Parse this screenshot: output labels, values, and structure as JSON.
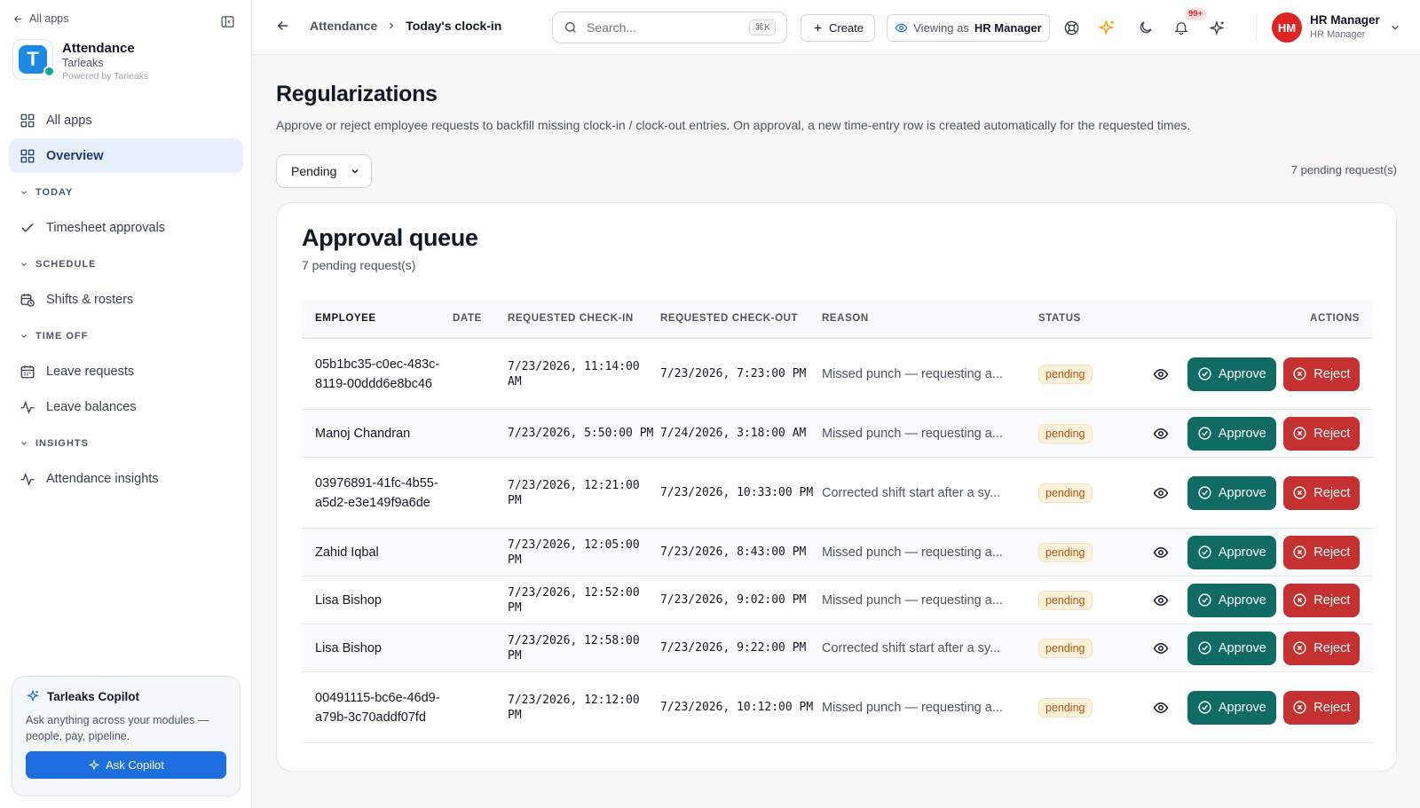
{
  "sidebar": {
    "all_apps_link": "All apps",
    "brand": {
      "name": "Attendance",
      "org": "Tarleaks",
      "powered": "Powered by Tarleaks",
      "logo_letter": "T"
    },
    "items": [
      {
        "label": "All apps",
        "icon": "grid-icon"
      },
      {
        "label": "Overview",
        "icon": "grid-icon",
        "active": true
      }
    ],
    "sections": [
      {
        "title": "TODAY",
        "items": [
          {
            "label": "Timesheet approvals",
            "icon": "check-icon"
          }
        ]
      },
      {
        "title": "SCHEDULE",
        "items": [
          {
            "label": "Shifts & rosters",
            "icon": "calendar-clock-icon"
          }
        ]
      },
      {
        "title": "TIME OFF",
        "items": [
          {
            "label": "Leave requests",
            "icon": "calendar-icon"
          },
          {
            "label": "Leave balances",
            "icon": "activity-icon"
          }
        ]
      },
      {
        "title": "INSIGHTS",
        "items": [
          {
            "label": "Attendance insights",
            "icon": "activity-icon"
          }
        ]
      }
    ],
    "copilot": {
      "title": "Tarleaks Copilot",
      "description": "Ask anything across your modules — people, pay, pipeline.",
      "button": "Ask Copilot"
    }
  },
  "topbar": {
    "breadcrumb": [
      "Attendance",
      "Today's clock-in"
    ],
    "search_placeholder": "Search...",
    "search_shortcut": "⌘K",
    "create_label": "Create",
    "viewing_label": "Viewing as",
    "viewing_role": "HR Manager",
    "notifications_badge": "99+",
    "user": {
      "initials": "HM",
      "name": "HR Manager",
      "role": "HR Manager"
    }
  },
  "page": {
    "title": "Regularizations",
    "description": "Approve or reject employee requests to backfill missing clock-in / clock-out entries. On approval, a new time-entry row is created automatically for the requested times.",
    "filter_value": "Pending",
    "pending_count": "7 pending request(s)"
  },
  "queue": {
    "title": "Approval queue",
    "subtitle": "7 pending request(s)",
    "columns": [
      "EMPLOYEE",
      "DATE",
      "REQUESTED CHECK-IN",
      "REQUESTED CHECK-OUT",
      "REASON",
      "STATUS",
      "ACTIONS"
    ],
    "approve_label": "Approve",
    "reject_label": "Reject",
    "rows": [
      {
        "employee": "05b1bc35-c0ec-483c-8119-00ddd6e8bc46",
        "date": "",
        "check_in": "7/23/2026, 11:14:00 AM",
        "check_out": "7/23/2026, 7:23:00 PM",
        "reason": "Missed punch — requesting a...",
        "status": "pending"
      },
      {
        "employee": "Manoj Chandran",
        "date": "",
        "check_in": "7/23/2026, 5:50:00 PM",
        "check_out": "7/24/2026, 3:18:00 AM",
        "reason": "Missed punch — requesting a...",
        "status": "pending"
      },
      {
        "employee": "03976891-41fc-4b55-a5d2-e3e149f9a6de",
        "date": "",
        "check_in": "7/23/2026, 12:21:00 PM",
        "check_out": "7/23/2026, 10:33:00 PM",
        "reason": "Corrected shift start after a sy...",
        "status": "pending"
      },
      {
        "employee": "Zahid Iqbal",
        "date": "",
        "check_in": "7/23/2026, 12:05:00 PM",
        "check_out": "7/23/2026, 8:43:00 PM",
        "reason": "Missed punch — requesting a...",
        "status": "pending"
      },
      {
        "employee": "Lisa Bishop",
        "date": "",
        "check_in": "7/23/2026, 12:52:00 PM",
        "check_out": "7/23/2026, 9:02:00 PM",
        "reason": "Missed punch — requesting a...",
        "status": "pending"
      },
      {
        "employee": "Lisa Bishop",
        "date": "",
        "check_in": "7/23/2026, 12:58:00 PM",
        "check_out": "7/23/2026, 9:22:00 PM",
        "reason": "Corrected shift start after a sy...",
        "status": "pending"
      },
      {
        "employee": "00491115-bc6e-46d9-a79b-3c70addf07fd",
        "date": "",
        "check_in": "7/23/2026, 12:12:00 PM",
        "check_out": "7/23/2026, 10:12:00 PM",
        "reason": "Missed punch — requesting a...",
        "status": "pending"
      }
    ]
  },
  "colors": {
    "accent": "#1d6fe0",
    "approve": "#0f6b63",
    "reject": "#c53030",
    "pending_bg": "#fdf1dc",
    "pending_text": "#b45309",
    "avatar": "#dc2626"
  }
}
